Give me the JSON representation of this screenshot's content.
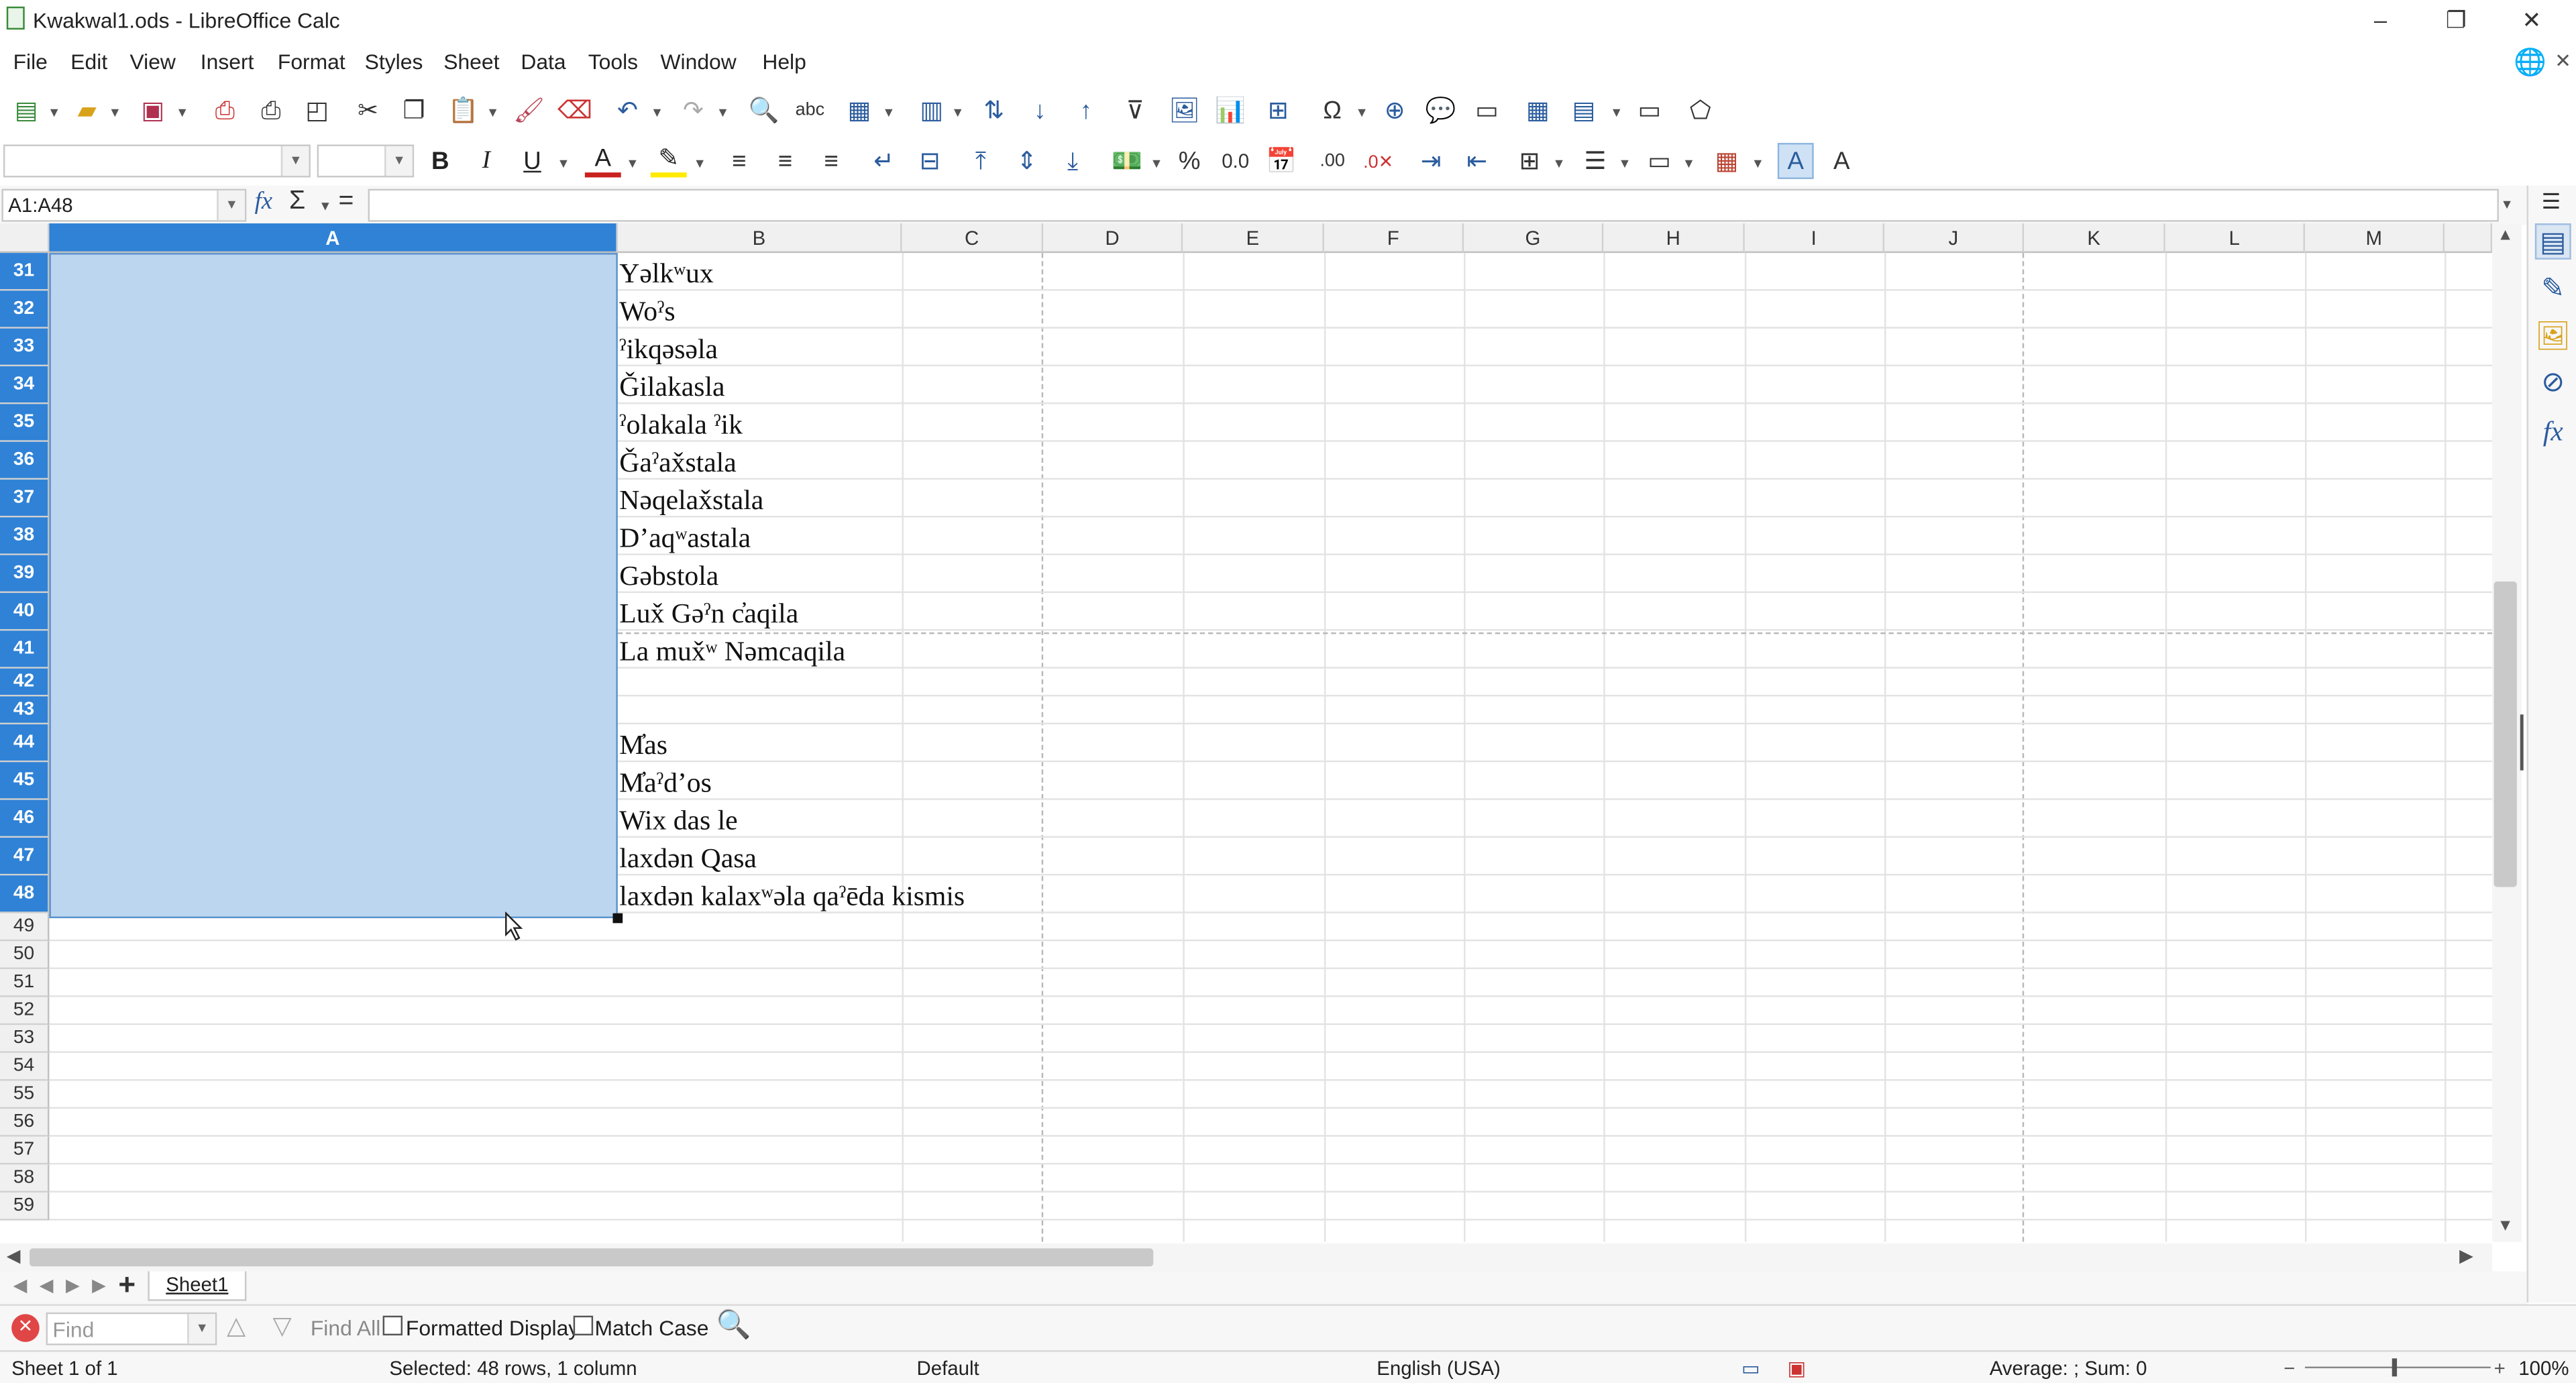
{
  "window": {
    "title": "Kwakwal1.ods - LibreOffice Calc",
    "minimize_glyph": "–",
    "restore_glyph": "❐",
    "close_glyph": "✕"
  },
  "menu": [
    "File",
    "Edit",
    "View",
    "Insert",
    "Format",
    "Styles",
    "Sheet",
    "Data",
    "Tools",
    "Window",
    "Help"
  ],
  "formula_bar": {
    "name_box": "A1:A48",
    "content": "",
    "fx_glyph": "fx",
    "sigma_glyph": "Σ",
    "equals_glyph": "="
  },
  "columns": [
    "A",
    "B",
    "C",
    "D",
    "E",
    "F",
    "G",
    "H",
    "I",
    "J",
    "K",
    "L",
    "M"
  ],
  "selected_column": "A",
  "rows": [
    {
      "num": "31",
      "b": "Yəlkʷux"
    },
    {
      "num": "32",
      "b": "Woˀs"
    },
    {
      "num": "33",
      "b": "ˀikqəsəla"
    },
    {
      "num": "34",
      "b": "Ǧilakasla"
    },
    {
      "num": "35",
      "b": "ˀolakala ˀik"
    },
    {
      "num": "36",
      "b": "Ǧaˀax̌stala"
    },
    {
      "num": "37",
      "b": "Nəqelax̌stala"
    },
    {
      "num": "38",
      "b": "Dʼaqʷastala"
    },
    {
      "num": "39",
      "b": "Gəbstola"
    },
    {
      "num": "40",
      "b": "Lux̌ Gəˀn c̓aqila"
    },
    {
      "num": "41",
      "b": "La mux̌ʷ Nəmcaqila"
    },
    {
      "num": "42",
      "b": ""
    },
    {
      "num": "43",
      "b": ""
    },
    {
      "num": "44",
      "b": "M̓as"
    },
    {
      "num": "45",
      "b": "M̓aˀdʼos"
    },
    {
      "num": "46",
      "b": "Wix das le"
    },
    {
      "num": "47",
      "b": "laxdən Qasa"
    },
    {
      "num": "48",
      "b": "laxdən kalaxʷəla  qaˀēda kismis"
    },
    {
      "num": "49",
      "b": ""
    },
    {
      "num": "50",
      "b": ""
    },
    {
      "num": "51",
      "b": ""
    },
    {
      "num": "52",
      "b": ""
    },
    {
      "num": "53",
      "b": ""
    },
    {
      "num": "54",
      "b": ""
    },
    {
      "num": "55",
      "b": ""
    },
    {
      "num": "56",
      "b": ""
    },
    {
      "num": "57",
      "b": ""
    },
    {
      "num": "58",
      "b": ""
    },
    {
      "num": "59",
      "b": ""
    }
  ],
  "sheet_tabs": {
    "add_glyph": "+",
    "tabs": [
      "Sheet1"
    ]
  },
  "find_bar": {
    "placeholder": "Find",
    "find_all": "Find All",
    "formatted_display": "Formatted Display",
    "match_case": "Match Case"
  },
  "status_bar": {
    "sheet": "Sheet 1 of 1",
    "selection": "Selected: 48 rows, 1 column",
    "page_style": "Default",
    "language": "English (USA)",
    "summary": "Average: ; Sum: 0",
    "zoom": "100%"
  },
  "colors": {
    "selection": "#bcd6ef",
    "header_selected": "#2f82d6",
    "accent": "#2b5c9e"
  }
}
